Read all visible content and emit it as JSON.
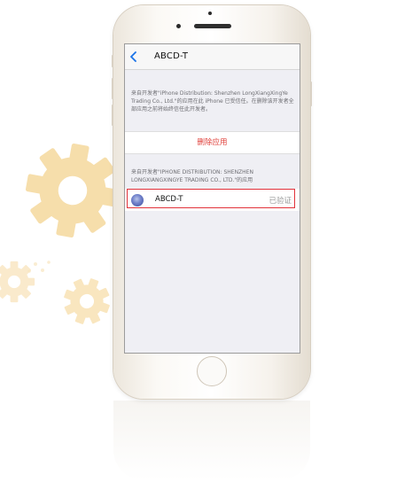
{
  "nav": {
    "title": "ABCD-T",
    "back_icon": "chevron-left-icon"
  },
  "section1": {
    "description": "来自开发者\"iPhone Distribution: Shenzhen LongXiangXingYe Trading Co., Ltd.\"的应用在此 iPhone 已受信任。在删除该开发者全部应用之前将始终信任此开发者。"
  },
  "delete_button": {
    "label": "删除应用"
  },
  "section2": {
    "description": "来自开发者\"IPHONE DISTRIBUTION: SHENZHEN LONGXIANGXINGYE TRADING CO., LTD.\"的应用"
  },
  "app_row": {
    "name": "ABCD-T",
    "status": "已验证"
  },
  "colors": {
    "gear": "#f6dba3",
    "delete_red": "#e0403b",
    "highlight_red": "#e2323a",
    "ios_blue": "#1a73e8"
  }
}
